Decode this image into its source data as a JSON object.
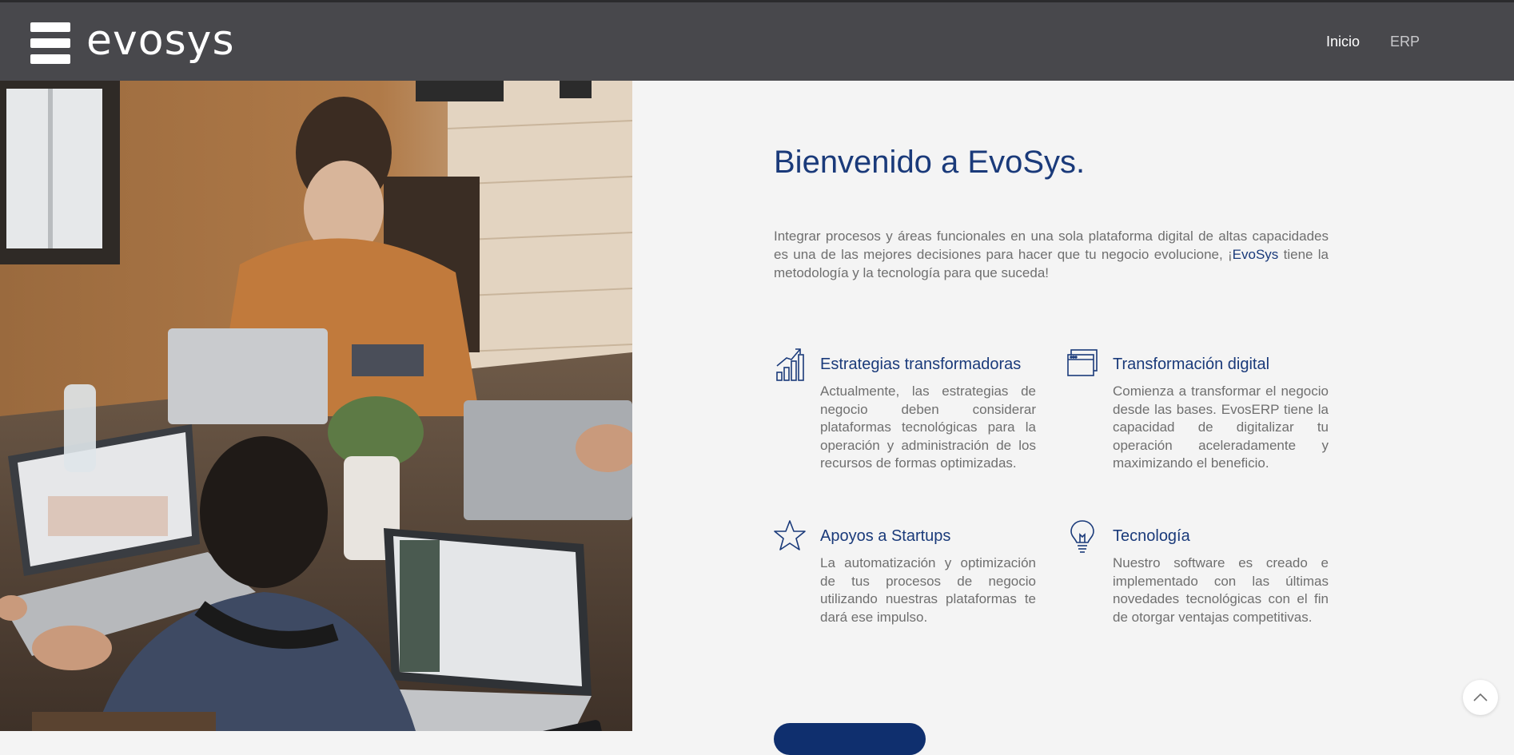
{
  "brand": {
    "logo_text": "evosys"
  },
  "nav": {
    "items": [
      {
        "label": "Inicio",
        "active": true
      },
      {
        "label": "ERP",
        "active": false
      }
    ]
  },
  "hero": {
    "image": "people-working-on-laptops-photo",
    "title": "Bienvenido a EvoSys.",
    "intro_before": "Integrar procesos y áreas funcionales en una sola plataforma digital de altas capacidades es una de las mejores decisiones para hacer que tu negocio evolucione, ¡",
    "intro_brand": "EvoSys",
    "intro_after": " tiene la metodología y la tecnología para que suceda!"
  },
  "features": [
    {
      "icon": "growth-chart-icon",
      "title": "Estrategias transformadoras",
      "text": "Actualmente, las estrategias de negocio deben considerar plataformas tecnológicas para la operación y administración de los recursos de formas optimizadas."
    },
    {
      "icon": "browser-window-icon",
      "title": "Transformación digital",
      "text": "Comienza a transformar el negocio desde las bases. EvosERP tiene la capacidad de digitalizar tu operación aceleradamente y maximizando el beneficio."
    },
    {
      "icon": "star-icon",
      "title": "Apoyos a Startups",
      "text": "La automatización y optimización de tus procesos de negocio utilizando nuestras plataformas te dará ese impulso."
    },
    {
      "icon": "lightbulb-icon",
      "title": "Tecnología",
      "text": "Nuestro software es creado e implementado con las últimas novedades tecnológicas con el fin de otorgar ventajas competitivas."
    }
  ],
  "scroll_top": {
    "icon": "chevron-up-icon"
  },
  "colors": {
    "navbar": "#48484c",
    "accent_blue": "#1a3a7a",
    "cta": "#0f2f6e",
    "body_text": "#6f6f6f",
    "background": "#f4f4f4"
  }
}
